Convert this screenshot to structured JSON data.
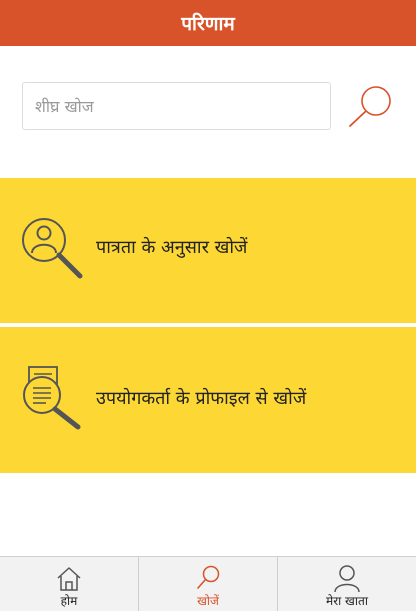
{
  "header": {
    "title": "परिणाम"
  },
  "search": {
    "placeholder": "शीघ्र खोज",
    "value": ""
  },
  "cards": [
    {
      "label": "पात्रता के अनुसार खोजें",
      "icon": "user-search-icon"
    },
    {
      "label": "उपयोगकर्ता के प्रोफाइल से खोजें",
      "icon": "document-search-icon"
    }
  ],
  "nav": {
    "items": [
      {
        "label": "होम",
        "icon": "home-icon",
        "active": false
      },
      {
        "label": "खोजें",
        "icon": "search-icon",
        "active": true
      },
      {
        "label": "मेरा खाता",
        "icon": "user-icon",
        "active": false
      }
    ]
  },
  "colors": {
    "accent": "#d9532a",
    "card_background": "#fdd835",
    "icon_stroke": "#555555",
    "nav_background": "#f2f2f2"
  }
}
